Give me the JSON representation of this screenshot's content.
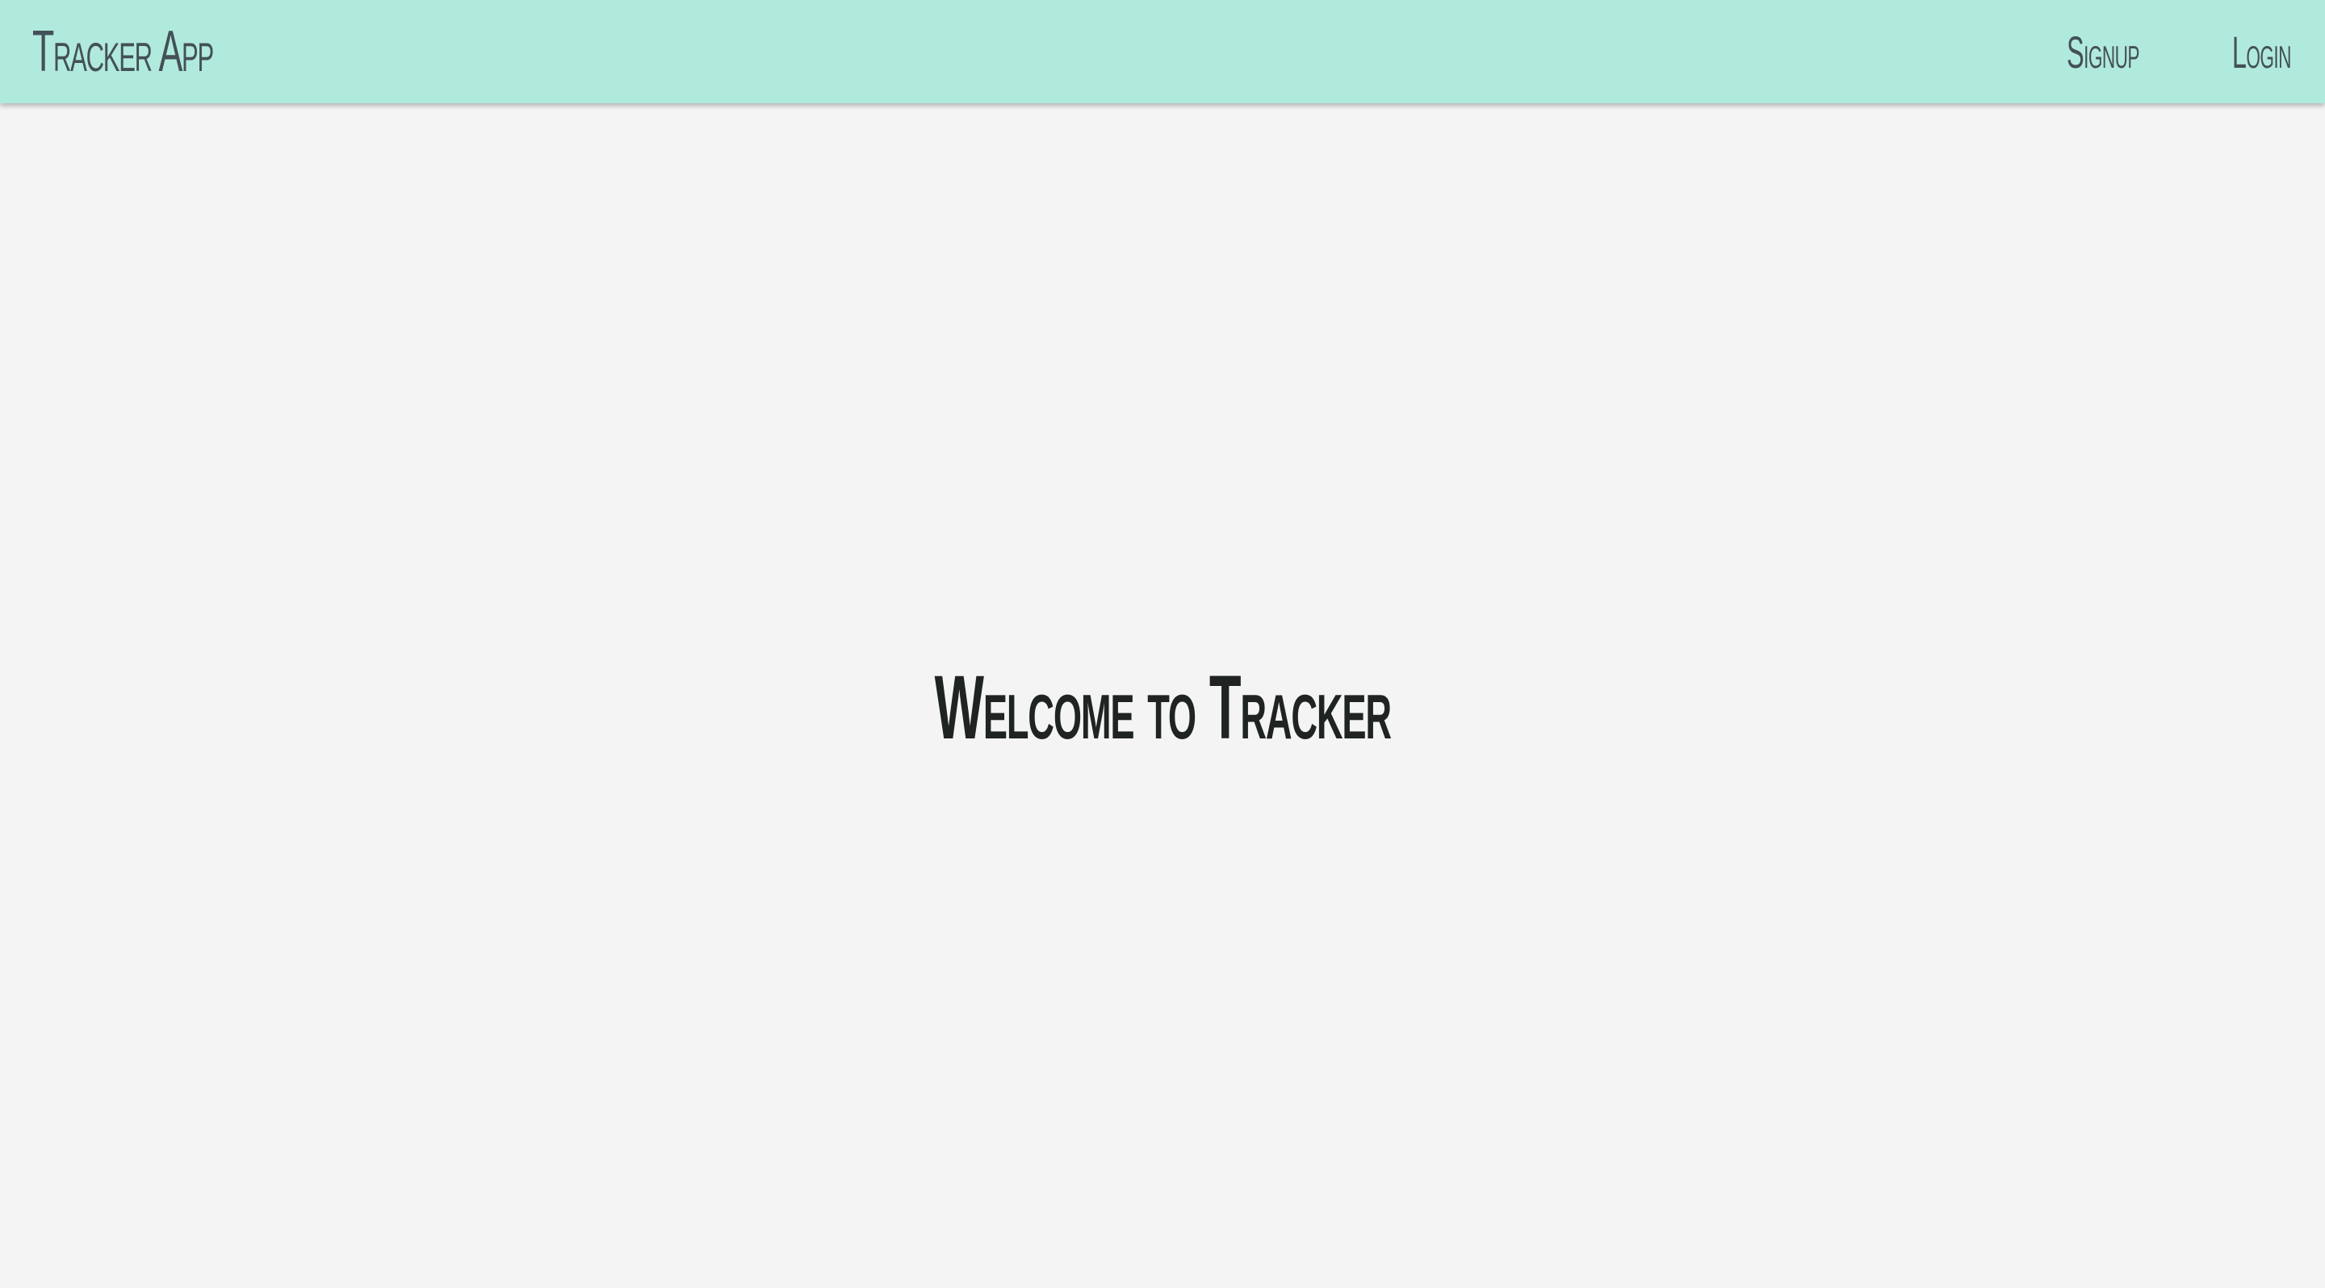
{
  "app": {
    "title": "Tracker App"
  },
  "nav": {
    "links": [
      {
        "label": "Signup"
      },
      {
        "label": "Login"
      }
    ]
  },
  "main": {
    "headline": "Welcome to Tracker"
  },
  "colors": {
    "navbar_background": "#b0eadc",
    "page_background": "#f4f4f4",
    "nav_text": "#445058",
    "headline_text": "#1f2322"
  }
}
